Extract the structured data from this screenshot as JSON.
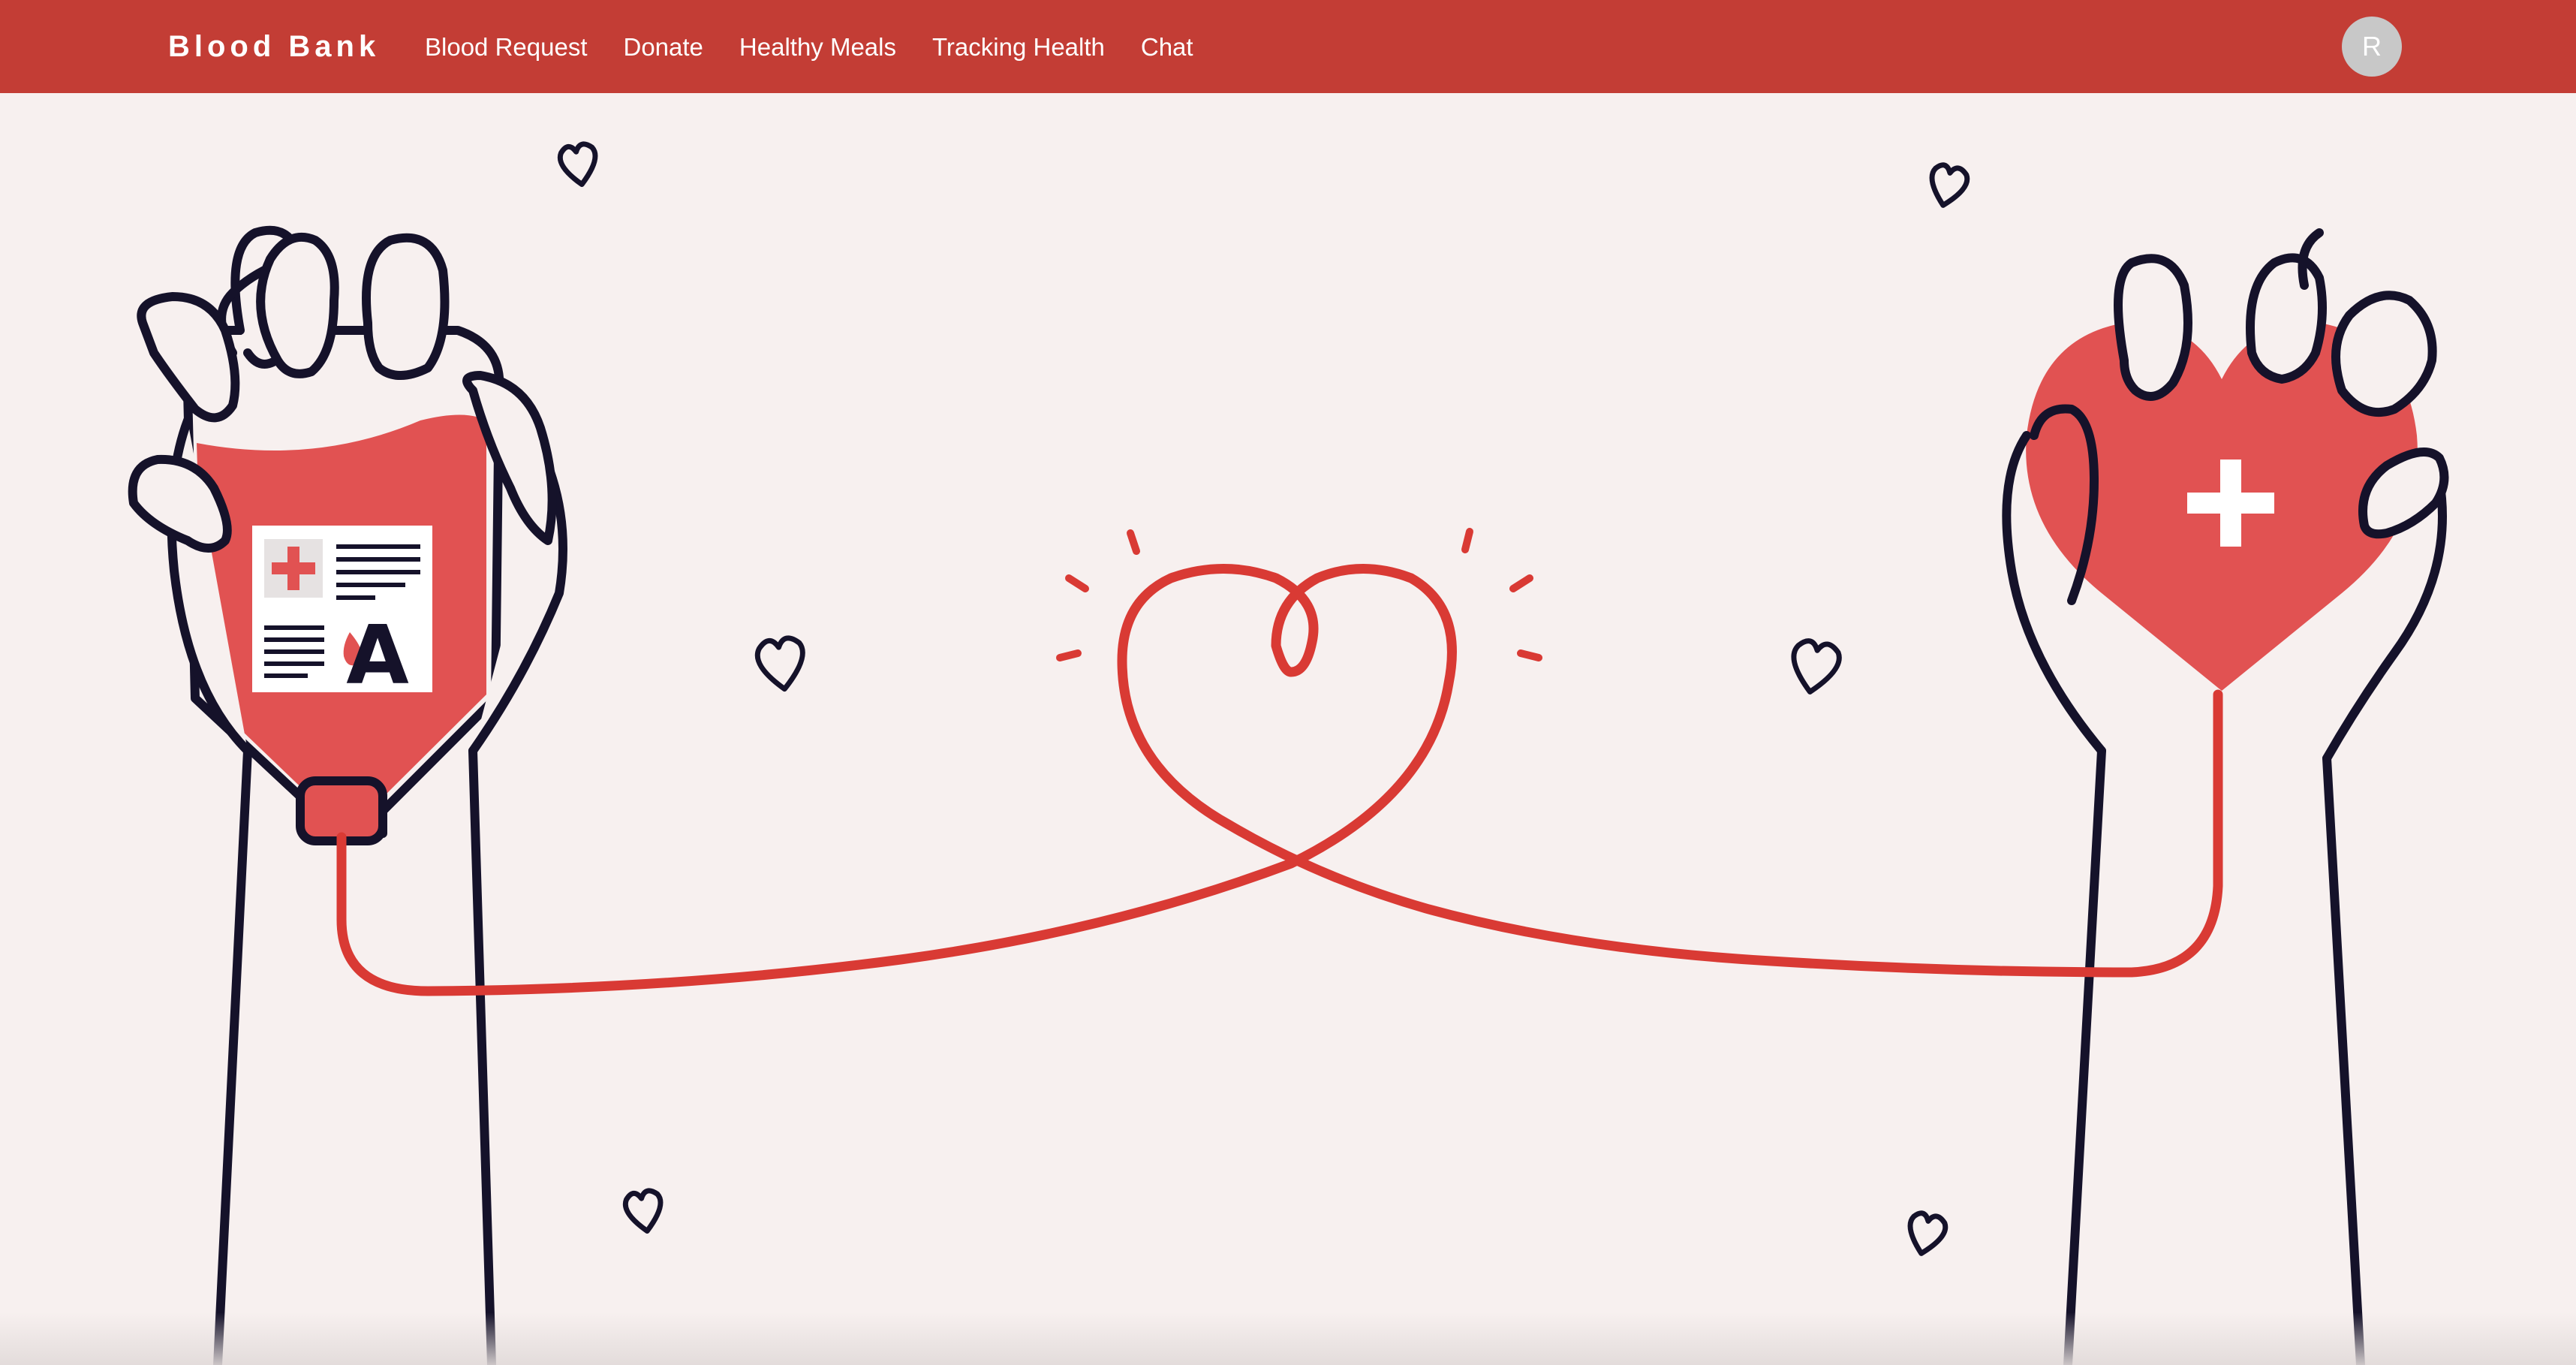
{
  "navbar": {
    "brand": "Blood Bank",
    "links": [
      {
        "label": "Blood Request"
      },
      {
        "label": "Donate"
      },
      {
        "label": "Healthy Meals"
      },
      {
        "label": "Tracking Health"
      },
      {
        "label": "Chat"
      }
    ],
    "avatar_initial": "R"
  },
  "hero": {
    "blood_bag_type": "A"
  },
  "colors": {
    "navbar": "#c33d35",
    "background": "#f7f0ef",
    "accent_red": "#e15252",
    "line_red": "#d93a34",
    "outline": "#15122a"
  }
}
